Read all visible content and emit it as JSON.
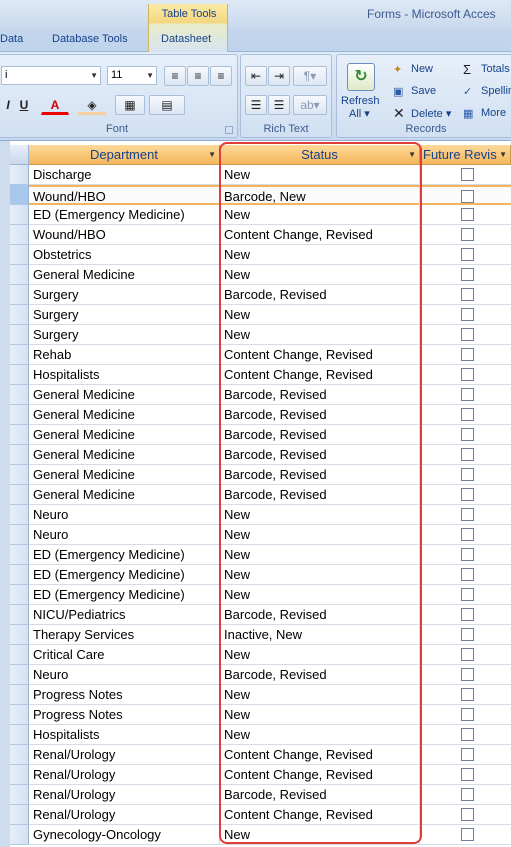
{
  "window": {
    "title": "Forms - Microsoft Acces",
    "context_tab_group": "Table Tools"
  },
  "ribbon_tabs": [
    "Data",
    "Database Tools",
    "Datasheet"
  ],
  "ribbon": {
    "font_group": {
      "label": "Font",
      "font_name": "i",
      "font_size": "11"
    },
    "rich_text_group": {
      "label": "Rich Text"
    },
    "records_group": {
      "label": "Records",
      "refresh_label": "Refresh",
      "refresh_sub": "All",
      "new_label": "New",
      "save_label": "Save",
      "delete_label": "Delete",
      "totals_label": "Totals",
      "spelling_label": "Spelling",
      "more_label": "More"
    }
  },
  "datasheet": {
    "columns": [
      "Department",
      "Status",
      "Future Revis"
    ],
    "selected_row_index": 1,
    "rows": [
      {
        "department": "Discharge",
        "status": "New"
      },
      {
        "department": "Wound/HBO",
        "status": "Barcode, New"
      },
      {
        "department": "ED (Emergency Medicine)",
        "status": "New"
      },
      {
        "department": "Wound/HBO",
        "status": "Content Change, Revised"
      },
      {
        "department": "Obstetrics",
        "status": "New"
      },
      {
        "department": "General Medicine",
        "status": "New"
      },
      {
        "department": "Surgery",
        "status": "Barcode, Revised"
      },
      {
        "department": "Surgery",
        "status": "New"
      },
      {
        "department": "Surgery",
        "status": "New"
      },
      {
        "department": "Rehab",
        "status": "Content Change, Revised"
      },
      {
        "department": "Hospitalists",
        "status": "Content Change, Revised"
      },
      {
        "department": "General Medicine",
        "status": "Barcode, Revised"
      },
      {
        "department": "General Medicine",
        "status": "Barcode, Revised"
      },
      {
        "department": "General Medicine",
        "status": "Barcode, Revised"
      },
      {
        "department": "General Medicine",
        "status": "Barcode, Revised"
      },
      {
        "department": "General Medicine",
        "status": "Barcode, Revised"
      },
      {
        "department": "General Medicine",
        "status": "Barcode, Revised"
      },
      {
        "department": "Neuro",
        "status": "New"
      },
      {
        "department": "Neuro",
        "status": "New"
      },
      {
        "department": "ED (Emergency Medicine)",
        "status": "New"
      },
      {
        "department": "ED (Emergency Medicine)",
        "status": "New"
      },
      {
        "department": "ED (Emergency Medicine)",
        "status": "New"
      },
      {
        "department": "NICU/Pediatrics",
        "status": "Barcode, Revised"
      },
      {
        "department": "Therapy Services",
        "status": "Inactive, New"
      },
      {
        "department": "Critical Care",
        "status": "New"
      },
      {
        "department": "Neuro",
        "status": "Barcode, Revised"
      },
      {
        "department": "Progress Notes",
        "status": "New"
      },
      {
        "department": "Progress Notes",
        "status": "New"
      },
      {
        "department": "Hospitalists",
        "status": "New"
      },
      {
        "department": "Renal/Urology",
        "status": "Content Change, Revised"
      },
      {
        "department": "Renal/Urology",
        "status": "Content Change, Revised"
      },
      {
        "department": "Renal/Urology",
        "status": "Barcode, Revised"
      },
      {
        "department": "Renal/Urology",
        "status": "Content Change, Revised"
      },
      {
        "department": "Gynecology-Oncology",
        "status": "New"
      }
    ]
  },
  "colors": {
    "header_fill": "#f6b65c",
    "annotation_box": "#e03c3c",
    "selected_row_border": "#f5b35a"
  }
}
